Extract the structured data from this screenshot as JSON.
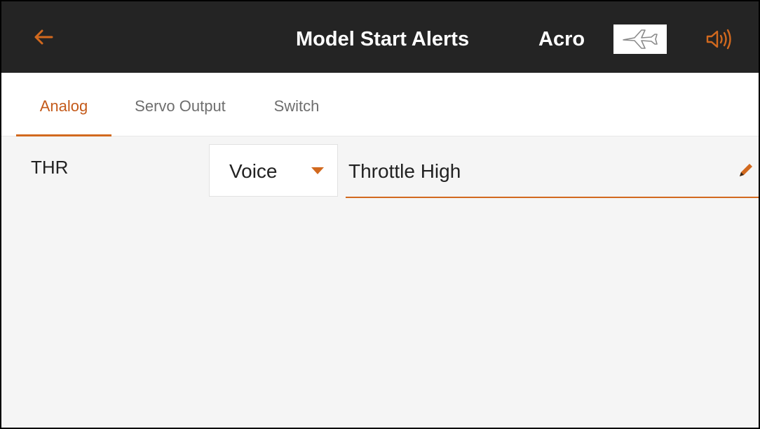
{
  "header": {
    "title": "Model Start Alerts",
    "model_name": "Acro",
    "back_icon": "arrow-left-icon",
    "model_icon": "airplane-icon",
    "speaker_icon": "speaker-volume-icon"
  },
  "tabs": [
    {
      "label": "Analog",
      "active": true
    },
    {
      "label": "Servo Output",
      "active": false
    },
    {
      "label": "Switch",
      "active": false
    }
  ],
  "alert_row": {
    "channel_label": "THR",
    "alert_type": "Voice",
    "alert_text": "Throttle High",
    "edit_icon": "pencil-icon"
  },
  "colors": {
    "accent": "#d2691e",
    "header_bg": "#242424",
    "content_bg": "#f5f5f5"
  }
}
